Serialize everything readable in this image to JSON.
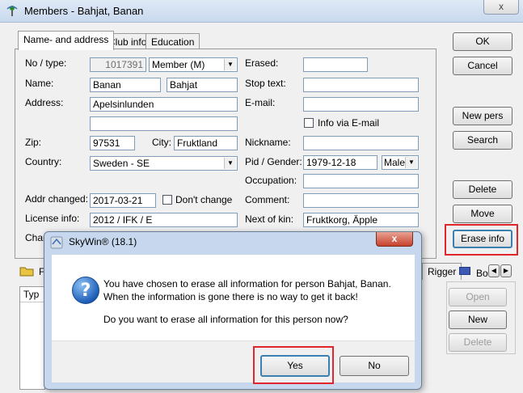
{
  "window": {
    "title": "Members - Bahjat, Banan",
    "close_symbol": "x"
  },
  "tabs": [
    {
      "label": "Name- and address"
    },
    {
      "label": "Club info"
    },
    {
      "label": "Education"
    }
  ],
  "form": {
    "no_type_label": "No / type:",
    "member_no": "1017391",
    "member_type": "Member  (M)",
    "name_label": "Name:",
    "first_name": "Banan",
    "last_name": "Bahjat",
    "address_label": "Address:",
    "address1": "Apelsinlunden",
    "address2": "",
    "zip_label": "Zip:",
    "zip": "97531",
    "city_label": "City:",
    "city": "Fruktland",
    "country_label": "Country:",
    "country": "Sweden - SE",
    "addr_changed_label": "Addr changed:",
    "addr_changed": "2017-03-21",
    "dont_change_label": "Don't change",
    "license_label": "License info:",
    "license": "2012 / IFK / E",
    "char_label": "Char",
    "erased_label": "Erased:",
    "erased": "",
    "stop_text_label": "Stop text:",
    "stop_text": "",
    "email_label": "E-mail:",
    "email": "",
    "info_via_email_label": "Info via E-mail",
    "nickname_label": "Nickname:",
    "nickname": "",
    "pid_gender_label": "Pid / Gender:",
    "pid": "1979-12-18",
    "gender": "Male",
    "occupation_label": "Occupation:",
    "occupation": "",
    "comment_label": "Comment:",
    "comment": "",
    "next_of_kin_label": "Next of kin:",
    "next_of_kin": "Fruktkorg, Äpple"
  },
  "buttons": {
    "ok": "OK",
    "cancel": "Cancel",
    "new_pers": "New pers",
    "search": "Search",
    "delete": "Delete",
    "move": "Move",
    "erase_info": "Erase info",
    "open": "Open",
    "new": "New",
    "delete_lower": "Delete"
  },
  "lower_tabs": {
    "first_label": "F",
    "rigger_label": "Rigger",
    "bo_label": "Bo",
    "nav_prev": "◀",
    "nav_next": "▶"
  },
  "lower_list": {
    "column_header": "Typ"
  },
  "dialog": {
    "title": "SkyWin® (18.1)",
    "close_symbol": "x",
    "icon_glyph": "?",
    "message_line1": "You have chosen to erase all information for person Bahjat, Banan.",
    "message_line2": "When the information is gone there is no way to get it back!",
    "question": "Do you want to erase all information for this person now?",
    "yes_label": "Yes",
    "no_label": "No"
  },
  "colors": {
    "highlight": "#e0262c",
    "titlebar": "#c8d9ee"
  }
}
